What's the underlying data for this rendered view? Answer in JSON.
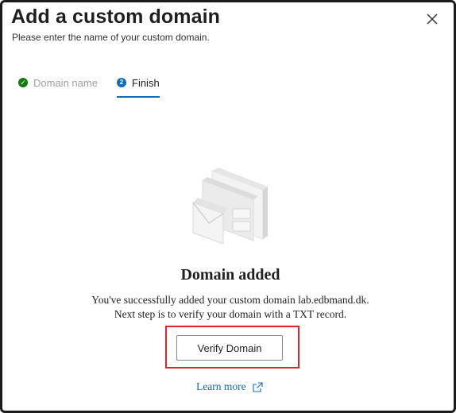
{
  "dialog": {
    "title": "Add a custom domain",
    "subtitle": "Please enter the name of your custom domain."
  },
  "icons": {
    "close": "close-icon",
    "step1": "checkmark-icon",
    "illustration": "domain-documents-illustration",
    "external": "external-link-icon"
  },
  "steps": [
    {
      "label": "Domain name",
      "status": "completed",
      "badge": "✓"
    },
    {
      "label": "Finish",
      "status": "active",
      "badge": "2"
    }
  ],
  "result": {
    "heading": "Domain added",
    "line1": "You've successfully added your custom domain lab.edbmand.dk.",
    "line2": "Next step is to verify your domain with a TXT record."
  },
  "actions": {
    "verify_label": "Verify Domain",
    "learn_more_label": "Learn more"
  },
  "colors": {
    "accent": "#0f6cbd",
    "success": "#107c10",
    "highlight": "#e0242b"
  }
}
